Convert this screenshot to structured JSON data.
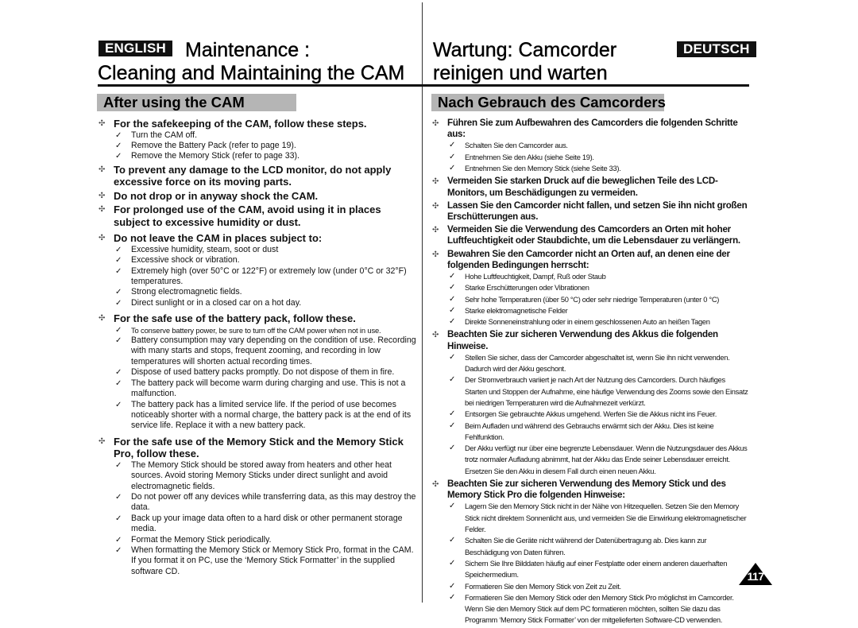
{
  "header": {
    "english_badge": "ENGLISH",
    "deutsch_badge": "DEUTSCH",
    "en_title_line1": "Maintenance :",
    "en_title_line2": "Cleaning and Maintaining the CAM",
    "de_title_line1": "Wartung: Camcorder",
    "de_title_line2": "reinigen und warten"
  },
  "english": {
    "section_title": "After using the CAM",
    "items": [
      {
        "head": "For the safekeeping of the CAM, follow these steps.",
        "subs": [
          "Turn the CAM off.",
          "Remove the Battery Pack (refer to page 19).",
          "Remove the Memory Stick (refer to page 33)."
        ]
      },
      {
        "head": "To prevent any damage to the LCD monitor, do not apply excessive force on its moving parts.",
        "subs": []
      },
      {
        "head": "Do not drop or in anyway shock the CAM.",
        "subs": []
      },
      {
        "head": "For prolonged use of the CAM, avoid using it in places subject to excessive humidity or dust.",
        "subs": []
      },
      {
        "head": "Do not leave the CAM in places subject to:",
        "subs": [
          "Excessive humidity, steam, soot or dust",
          "Excessive shock or vibration.",
          "Extremely high (over 50°C or 122°F) or extremely low (under 0°C or 32°F) temperatures.",
          "Strong electromagnetic fields.",
          "Direct sunlight or in a closed car on a hot day."
        ]
      },
      {
        "head": "For the safe use of the battery pack, follow these.",
        "subs": [
          "To conserve battery power, be sure to turn off the CAM power when not in use.",
          "Battery consumption may vary depending on the condition of use. Recording with many starts and stops, frequent zooming, and recording in low temperatures will shorten actual recording times.",
          "Dispose of used battery packs promptly. Do not dispose of them in fire.",
          "The battery pack will become warm during charging and use. This is not a malfunction.",
          "The battery pack has a limited service life. If the period of use becomes noticeably shorter with a normal charge, the battery pack is at the end of its service life. Replace it with a new battery pack."
        ]
      },
      {
        "head": "For the safe use of the Memory Stick and the Memory Stick Pro, follow these.",
        "subs": [
          "The Memory Stick should be stored away from heaters and other heat sources. Avoid storing Memory Sticks under direct sunlight and avoid electromagnetic fields.",
          "Do not power off any devices while transferring data, as this may destroy the data.",
          "Back up your image data often to a hard disk or other permanent storage media.",
          "Format the Memory Stick periodically.",
          "When formatting the Memory Stick or Memory Stick Pro, format in the CAM. If you format it on PC, use the ‘Memory Stick Formatter’ in the supplied software CD."
        ]
      }
    ]
  },
  "deutsch": {
    "section_title": "Nach Gebrauch des Camcorders",
    "items": [
      {
        "head": "Führen Sie zum Aufbewahren des Camcorders die folgenden Schritte aus:",
        "subs": [
          "Schalten Sie den Camcorder aus.",
          "Entnehmen Sie den Akku (siehe Seite 19).",
          "Entnehmen Sie den Memory Stick (siehe Seite 33)."
        ]
      },
      {
        "head": "Vermeiden Sie starken Druck auf die beweglichen Teile des LCD-Monitors, um Beschädigungen zu vermeiden.",
        "subs": []
      },
      {
        "head": "Lassen Sie den Camcorder nicht fallen, und setzen Sie ihn nicht großen Erschütterungen aus.",
        "subs": []
      },
      {
        "head": "Vermeiden Sie die Verwendung des Camcorders an Orten mit hoher Luftfeuchtigkeit oder Staubdichte, um die Lebensdauer zu verlängern.",
        "subs": []
      },
      {
        "head": "Bewahren Sie den Camcorder nicht an Orten auf, an denen eine der folgenden Bedingungen herrscht:",
        "subs": [
          "Hohe Luftfeuchtigkeit, Dampf, Ruß oder Staub",
          "Starke Erschütterungen oder Vibrationen",
          "Sehr hohe Temperaturen (über 50 °C) oder sehr niedrige Temperaturen (unter 0 °C)",
          "Starke elektromagnetische Felder",
          "Direkte Sonneneinstrahlung oder in einem geschlossenen Auto an heißen Tagen"
        ]
      },
      {
        "head": "Beachten Sie zur sicheren Verwendung des Akkus die folgenden Hinweise.",
        "subs": [
          "Stellen Sie sicher, dass der Camcorder abgeschaltet ist, wenn Sie ihn nicht verwenden. Dadurch wird der Akku geschont.",
          "Der Stromverbrauch variiert je nach Art der Nutzung des Camcorders. Durch häufiges Starten und Stoppen der Aufnahme, eine häufige Verwendung des Zooms sowie den Einsatz bei niedrigen Temperaturen wird die Aufnahmezeit verkürzt.",
          "Entsorgen Sie gebrauchte Akkus umgehend. Werfen Sie die Akkus nicht ins Feuer.",
          "Beim Aufladen und während des Gebrauchs erwärmt sich der Akku. Dies ist keine Fehlfunktion.",
          "Der Akku verfügt nur über eine begrenzte Lebensdauer. Wenn die Nutzungsdauer des Akkus trotz normaler Aufladung abnimmt, hat der Akku das Ende seiner Lebensdauer erreicht. Ersetzen Sie den Akku in diesem Fall durch einen neuen Akku."
        ]
      },
      {
        "head": "Beachten Sie zur sicheren Verwendung des Memory Stick und des Memory Stick Pro die folgenden Hinweise:",
        "subs": [
          "Lagern Sie den Memory Stick nicht in der Nähe von Hitzequellen. Setzen Sie den Memory Stick nicht direktem Sonnenlicht aus, und vermeiden Sie die Einwirkung elektromagnetischer Felder.",
          "Schalten Sie die Geräte nicht während der Datenübertragung ab. Dies kann zur Beschädigung von Daten führen.",
          "Sichern Sie Ihre Bilddaten häufig auf einer Festplatte oder einem anderen dauerhaften Speichermedium.",
          "Formatieren Sie den Memory Stick von Zeit zu Zeit.",
          "Formatieren Sie den Memory Stick oder den Memory Stick Pro möglichst im Camcorder. Wenn Sie den Memory Stick auf dem PC formatieren möchten, sollten Sie dazu das Programm ‘Memory Stick Formatter’ von der mitgelieferten Software-CD verwenden."
        ]
      }
    ]
  },
  "symbols": {
    "bullet": "✣",
    "check": "✓"
  },
  "page_number": "117"
}
